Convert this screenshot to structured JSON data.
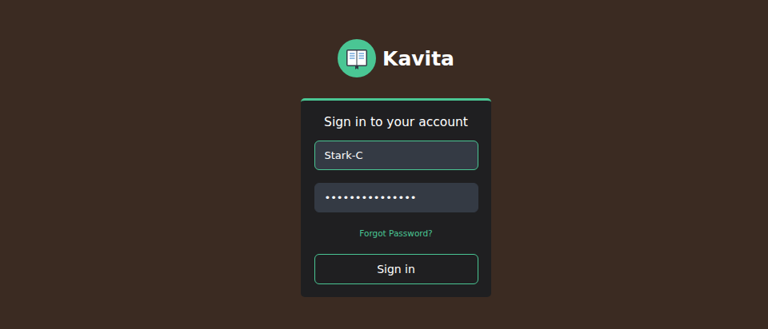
{
  "app": {
    "name": "Kavita"
  },
  "login": {
    "title": "Sign in to your account",
    "username": {
      "value": "Stark-C",
      "focused": true
    },
    "password": {
      "masked": "•••••••••••••••",
      "focused": false
    },
    "forgot_link": "Forgot Password?",
    "submit_button": "Sign in"
  }
}
